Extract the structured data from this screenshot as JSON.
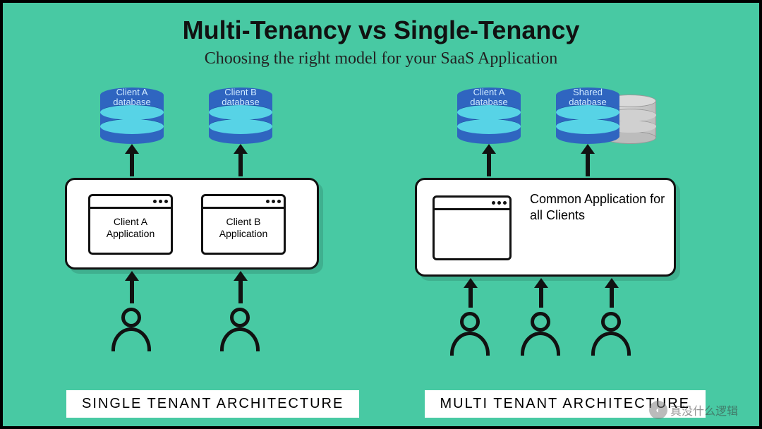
{
  "title": "Multi-Tenancy vs Single-Tenancy",
  "subtitle": "Choosing the right model for your  SaaS Application",
  "single": {
    "db_a": "Client A\ndatabase",
    "db_b": "Client B\ndatabase",
    "app_a": "Client A Application",
    "app_b": "Client B Application",
    "footer": "SINGLE TENANT ARCHITECTURE"
  },
  "multi": {
    "db_a": "Client A\ndatabase",
    "db_shared": "Shared\ndatabase",
    "common": "Common Application for all Clients",
    "footer": "MULTI TENANT ARCHITECTURE"
  },
  "watermark": "真没什么逻辑"
}
